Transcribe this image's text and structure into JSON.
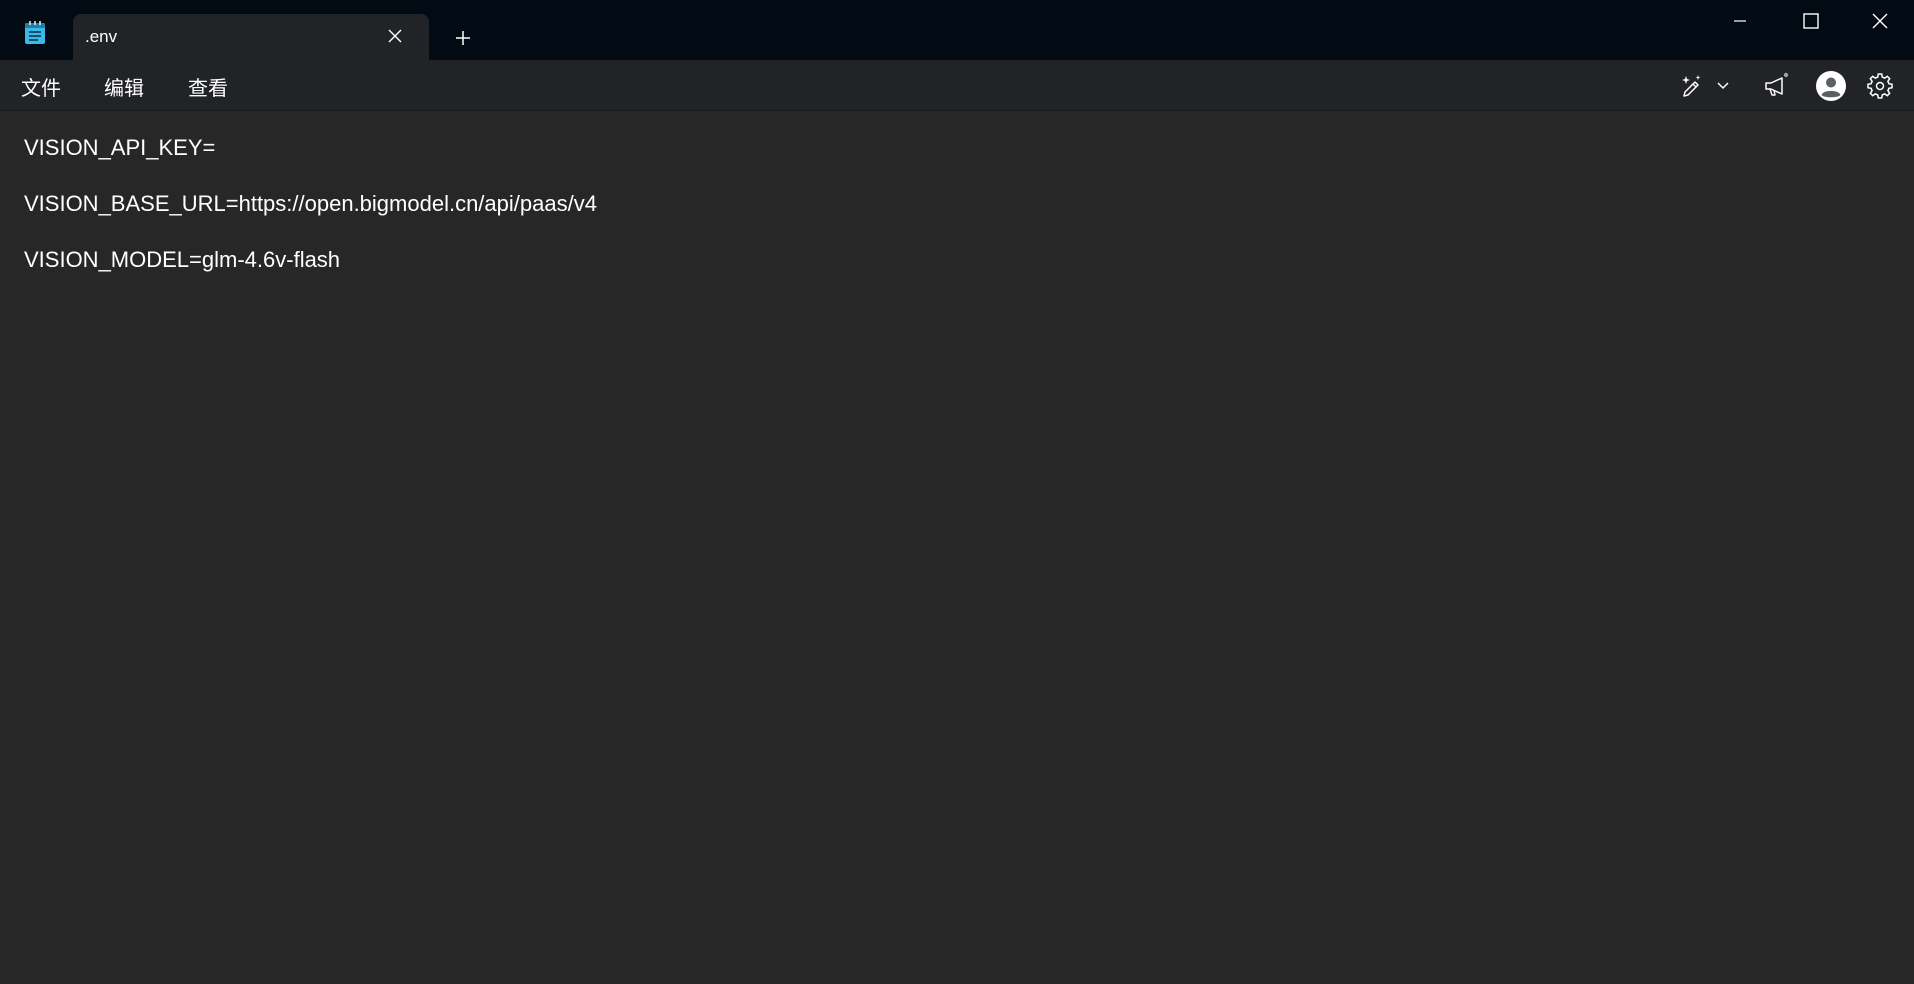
{
  "tab": {
    "title": ".env"
  },
  "menu": {
    "file": "文件",
    "edit": "编辑",
    "view": "查看"
  },
  "toolbar": {
    "icons": [
      "copilot-icon",
      "chevron-down-icon",
      "megaphone-icon",
      "avatar-icon",
      "gear-icon"
    ],
    "notification_dot": true
  },
  "window_controls": [
    "minimize-icon",
    "maximize-icon",
    "close-icon"
  ],
  "editor": {
    "lines": [
      "VISION_API_KEY=",
      "VISION_BASE_URL=https://open.bigmodel.cn/api/paas/v4",
      "VISION_MODEL=glm-4.6v-flash"
    ]
  },
  "colors": {
    "titlebar_bg": "#020b13",
    "menubar_bg": "#212326",
    "editor_bg": "#272727",
    "text": "#ffffff",
    "app_icon_accent": "#3bb8e6"
  }
}
